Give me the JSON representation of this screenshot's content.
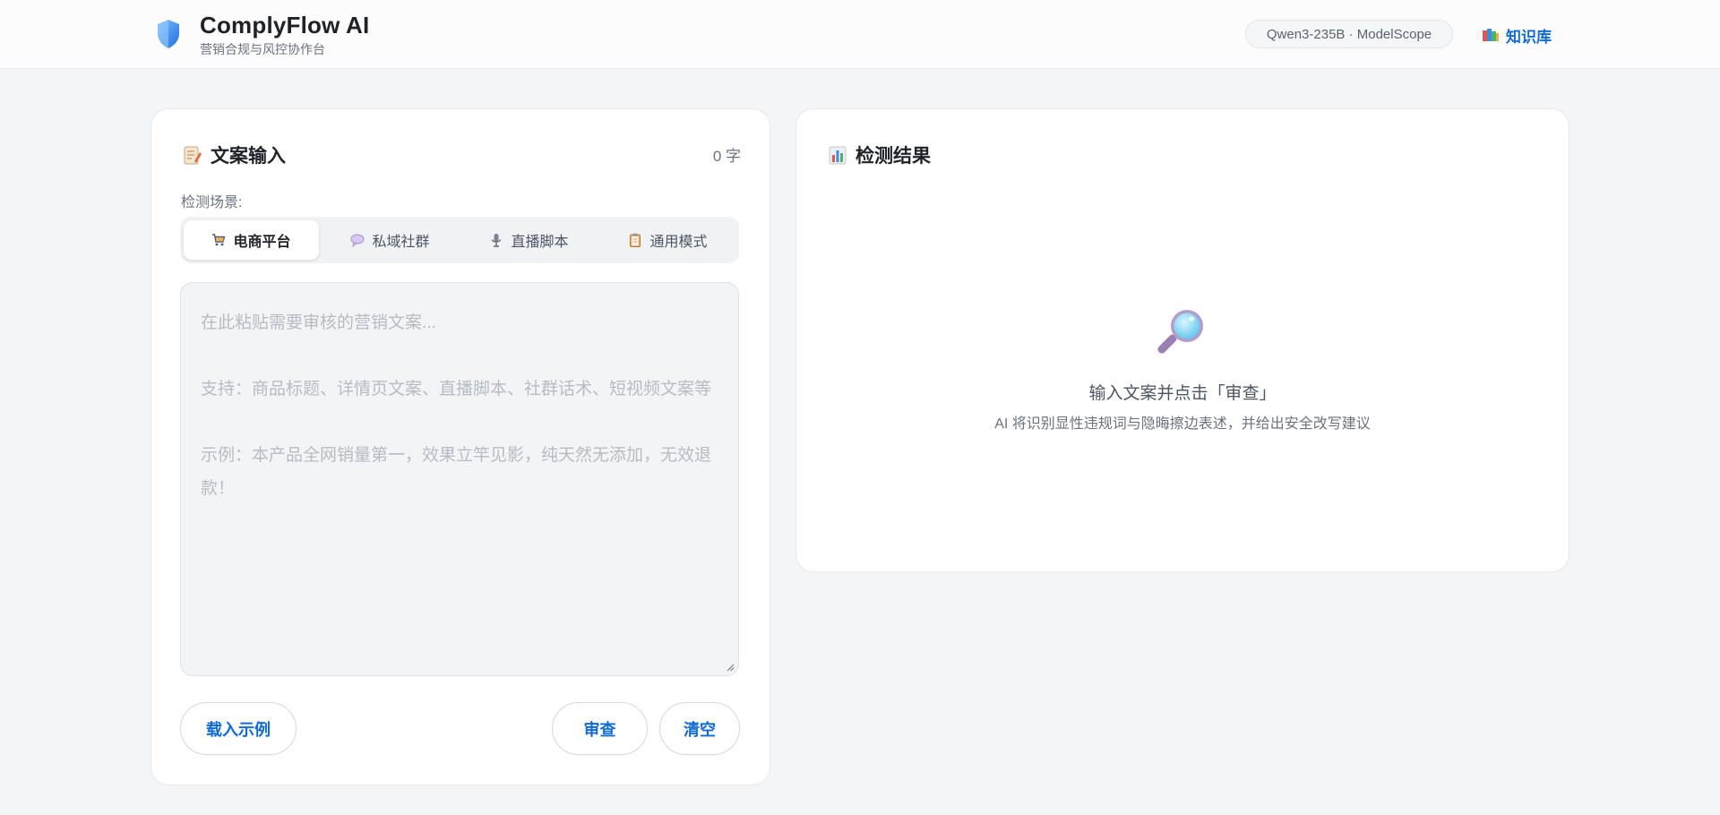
{
  "header": {
    "title": "ComplyFlow AI",
    "subtitle": "营销合规与风控协作台",
    "model_badge": "Qwen3-235B · ModelScope",
    "knowledge_link": "知识库",
    "logo_icon": "shield-icon",
    "knowledge_icon": "books-icon"
  },
  "input_panel": {
    "title": "文案输入",
    "title_icon": "memo-icon",
    "char_count": "0 字",
    "scene_label": "检测场景:",
    "tabs": [
      {
        "label": "电商平台",
        "icon": "shopping-cart-icon",
        "active": true
      },
      {
        "label": "私域社群",
        "icon": "speech-bubble-icon",
        "active": false
      },
      {
        "label": "直播脚本",
        "icon": "microphone-icon",
        "active": false
      },
      {
        "label": "通用模式",
        "icon": "clipboard-icon",
        "active": false
      }
    ],
    "textarea_value": "",
    "textarea_placeholder": "在此粘贴需要审核的营销文案...\n\n支持：商品标题、详情页文案、直播脚本、社群话术、短视频文案等\n\n示例：本产品全网销量第一，效果立竿见影，纯天然无添加，无效退款！",
    "buttons": {
      "load_example": "载入示例",
      "review": "审查",
      "clear": "清空"
    }
  },
  "result_panel": {
    "title": "检测结果",
    "title_icon": "bar-chart-icon",
    "empty_icon": "magnifier-icon",
    "empty_title": "输入文案并点击「审查」",
    "empty_desc": "AI 将识别显性违规词与隐晦擦边表述，并给出安全改写建议"
  },
  "colors": {
    "accent": "#0f6ad8",
    "page_bg": "#f4f5f7",
    "card_bg": "#ffffff",
    "input_bg": "#f3f4f6"
  }
}
